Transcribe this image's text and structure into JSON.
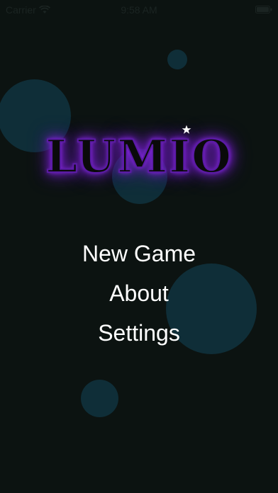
{
  "status_bar": {
    "carrier": "Carrier",
    "time": "9:58 AM",
    "wifi_icon": "wifi-icon",
    "battery_icon": "battery-icon"
  },
  "logo": {
    "title": "LUMIO",
    "star_icon": "star-icon",
    "glow_color": "#7b1fd6"
  },
  "menu": {
    "items": [
      {
        "label": "New Game"
      },
      {
        "label": "About"
      },
      {
        "label": "Settings"
      }
    ]
  },
  "colors": {
    "background": "#0c1311",
    "bubble": "#0f2e38",
    "menu_text": "#ffffff"
  }
}
